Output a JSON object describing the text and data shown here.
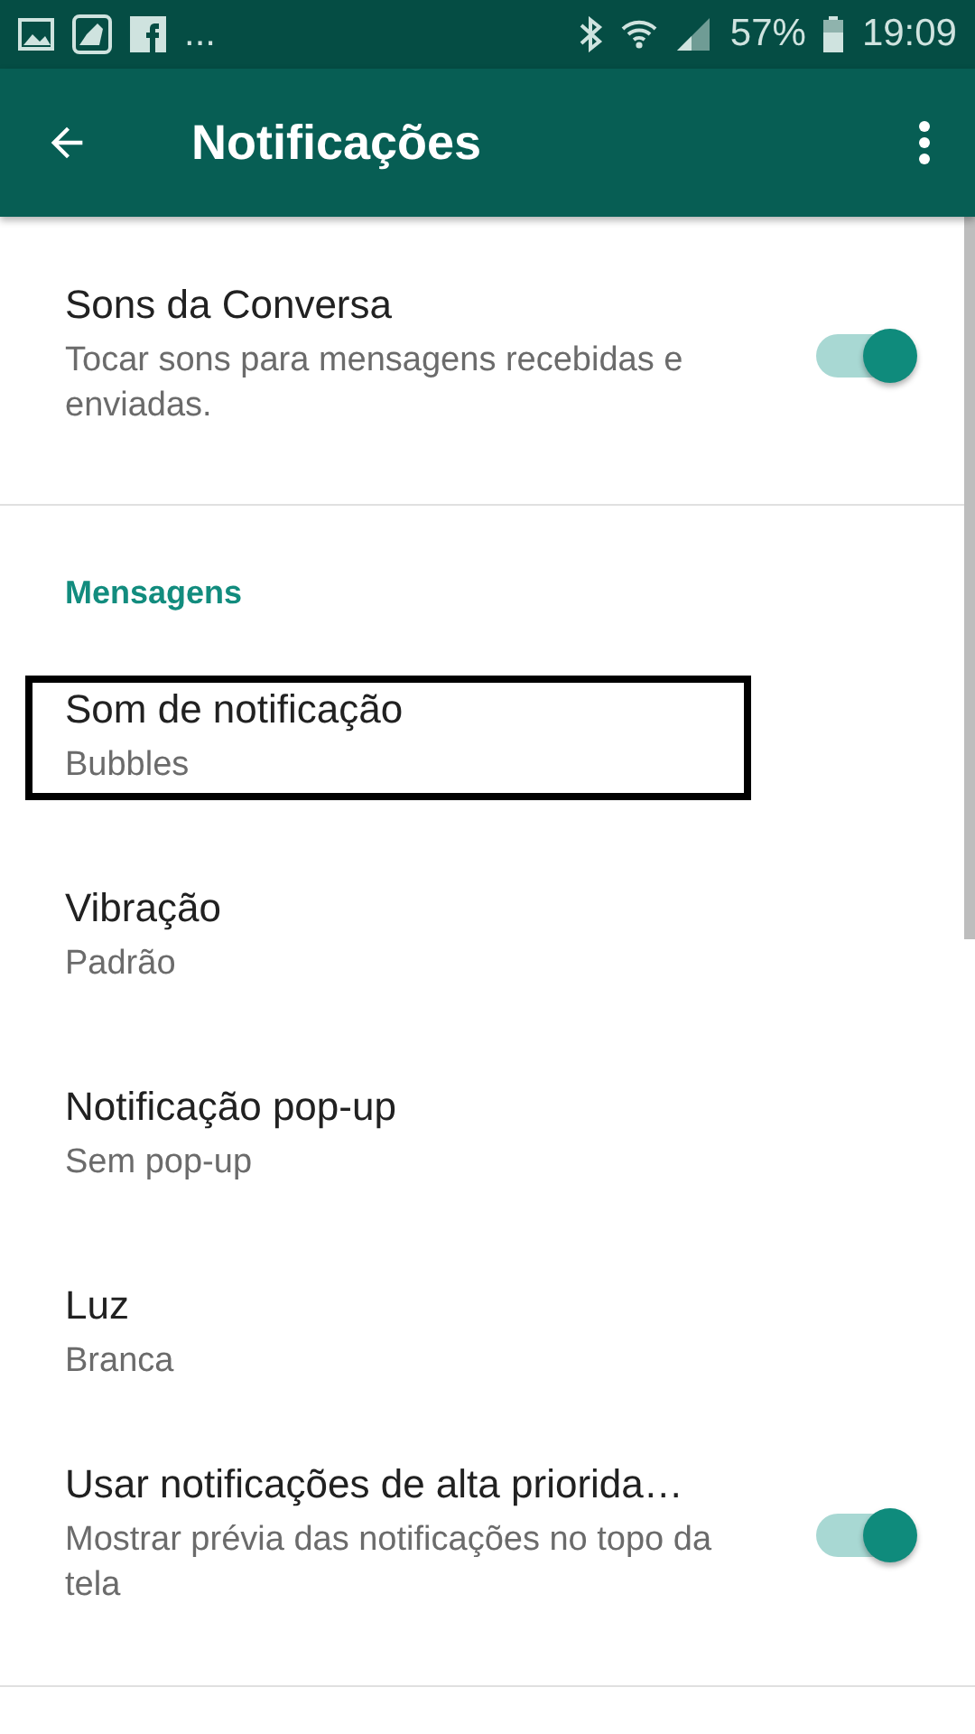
{
  "status_bar": {
    "more": "...",
    "battery": "57%",
    "time": "19:09"
  },
  "app_bar": {
    "title": "Notificações"
  },
  "sections": [
    {
      "items": [
        {
          "kind": "switch",
          "title": "Sons da Conversa",
          "subtitle": "Tocar sons para mensagens recebidas e enviadas.",
          "on": true,
          "highlighted": false
        }
      ]
    },
    {
      "header": "Mensagens",
      "items": [
        {
          "kind": "value",
          "title": "Som de notificação",
          "subtitle": "Bubbles",
          "highlighted": true
        },
        {
          "kind": "value",
          "title": "Vibração",
          "subtitle": "Padrão",
          "highlighted": false
        },
        {
          "kind": "value",
          "title": "Notificação pop-up",
          "subtitle": "Sem pop-up",
          "highlighted": false
        },
        {
          "kind": "value",
          "title": "Luz",
          "subtitle": "Branca",
          "highlighted": false
        },
        {
          "kind": "switch",
          "title": "Usar notificações de alta priorida…",
          "subtitle": "Mostrar prévia das notificações no topo da tela",
          "on": true,
          "highlighted": false
        }
      ]
    }
  ]
}
